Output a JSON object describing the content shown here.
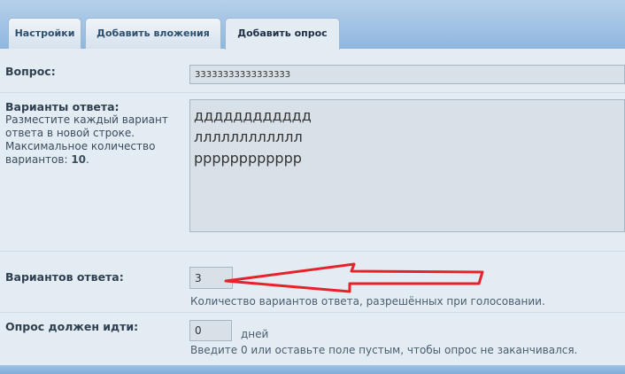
{
  "tabs": [
    {
      "label": "Настройки",
      "active": false
    },
    {
      "label": "Добавить вложения",
      "active": false
    },
    {
      "label": "Добавить опрос",
      "active": true
    }
  ],
  "question": {
    "label": "Вопрос:",
    "value": "33333333333333333"
  },
  "options": {
    "label": "Варианты ответа:",
    "description_line1": "Разместите каждый вариант",
    "description_line2": "ответа в новой строке.",
    "description_line3": "Максимальное количество",
    "description_line4_prefix": "вариантов: ",
    "max_count": "10",
    "description_line4_suffix": ".",
    "value": "дддддддддддд\nлллллллллллл\nрррррррррррр"
  },
  "answer_count": {
    "label": "Вариантов ответа:",
    "value": "3",
    "hint": "Количество вариантов ответа, разрешённых при голосовании."
  },
  "duration": {
    "label": "Опрос должен идти:",
    "value": "0",
    "unit": "дней",
    "hint": "Введите 0 или оставьте поле пустым, чтобы опрос не заканчивался."
  },
  "colors": {
    "accent_blue": "#8fb7de",
    "arrow_red": "#e8222a"
  }
}
